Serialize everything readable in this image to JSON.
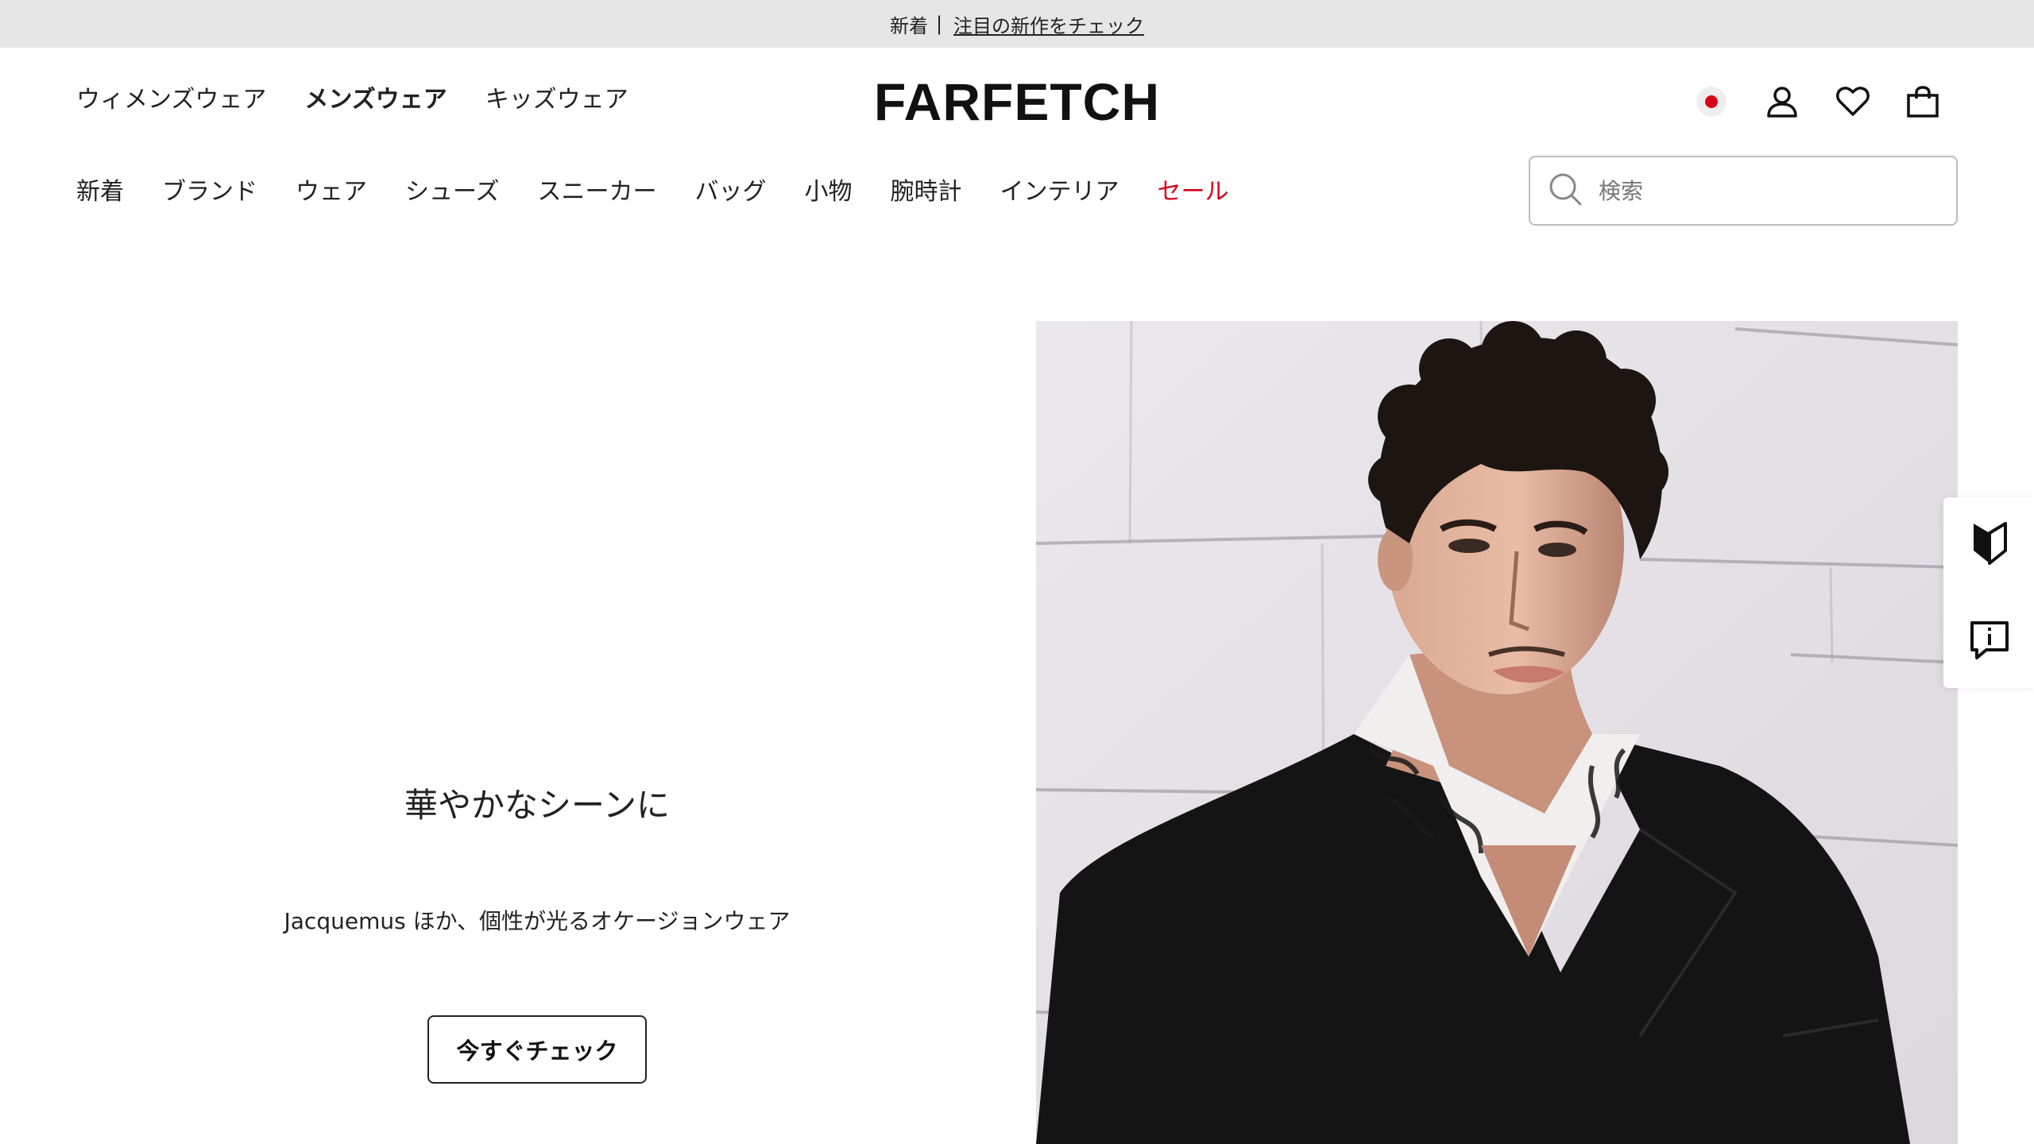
{
  "promo": {
    "label": "新着",
    "separator": "|",
    "link": "注目の新作をチェック"
  },
  "gender_nav": [
    {
      "label": "ウィメンズウェア",
      "active": false
    },
    {
      "label": "メンズウェア",
      "active": true
    },
    {
      "label": "キッズウェア",
      "active": false
    }
  ],
  "logo": "FARFETCH",
  "utility_icons": [
    "japan-flag-icon",
    "account-icon",
    "wishlist-heart-icon",
    "shopping-bag-icon"
  ],
  "category_nav": [
    {
      "label": "新着"
    },
    {
      "label": "ブランド"
    },
    {
      "label": "ウェア"
    },
    {
      "label": "シューズ"
    },
    {
      "label": "スニーカー"
    },
    {
      "label": "バッグ"
    },
    {
      "label": "小物"
    },
    {
      "label": "腕時計"
    },
    {
      "label": "インテリア"
    },
    {
      "label": "セール",
      "highlight": "#d6001c"
    }
  ],
  "search": {
    "placeholder": "検索",
    "value": ""
  },
  "hero": {
    "title": "華やかなシーンに",
    "subtitle": "Jacquemus ほか、個性が光るオケージョンウェア",
    "cta": "今すぐチェック"
  },
  "side_widget": {
    "icons": [
      "beginner-mark-icon",
      "feedback-icon"
    ]
  },
  "colors": {
    "promo_bg": "#e6e6e6",
    "sale_red": "#d6001c",
    "text": "#222222"
  }
}
